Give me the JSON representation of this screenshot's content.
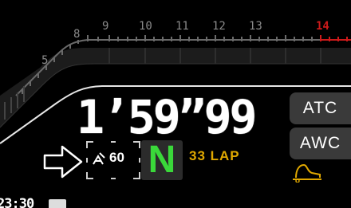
{
  "rpm_scale": {
    "labels": [
      "5",
      "8",
      "9",
      "10",
      "11",
      "12",
      "13",
      "14"
    ],
    "redline_label": "14"
  },
  "lap_time": "1’59”99",
  "side_buttons": {
    "atc": "ATC",
    "awc": "AWC"
  },
  "gear": "N",
  "lap_count": "33 LAP",
  "assist": {
    "value": "60",
    "icon": "driving-assist-icon"
  },
  "clock": "23:30",
  "icons": {
    "arrow": "arrow-right-icon",
    "traction": "traction-icon",
    "display": "display-icon"
  },
  "colors": {
    "rpm_gray": "#8a8a8a",
    "redline": "#cc1a1a",
    "gear": "#3ad83a",
    "lap_count": "#e0a800",
    "button_bg": "#3a3a3a"
  }
}
